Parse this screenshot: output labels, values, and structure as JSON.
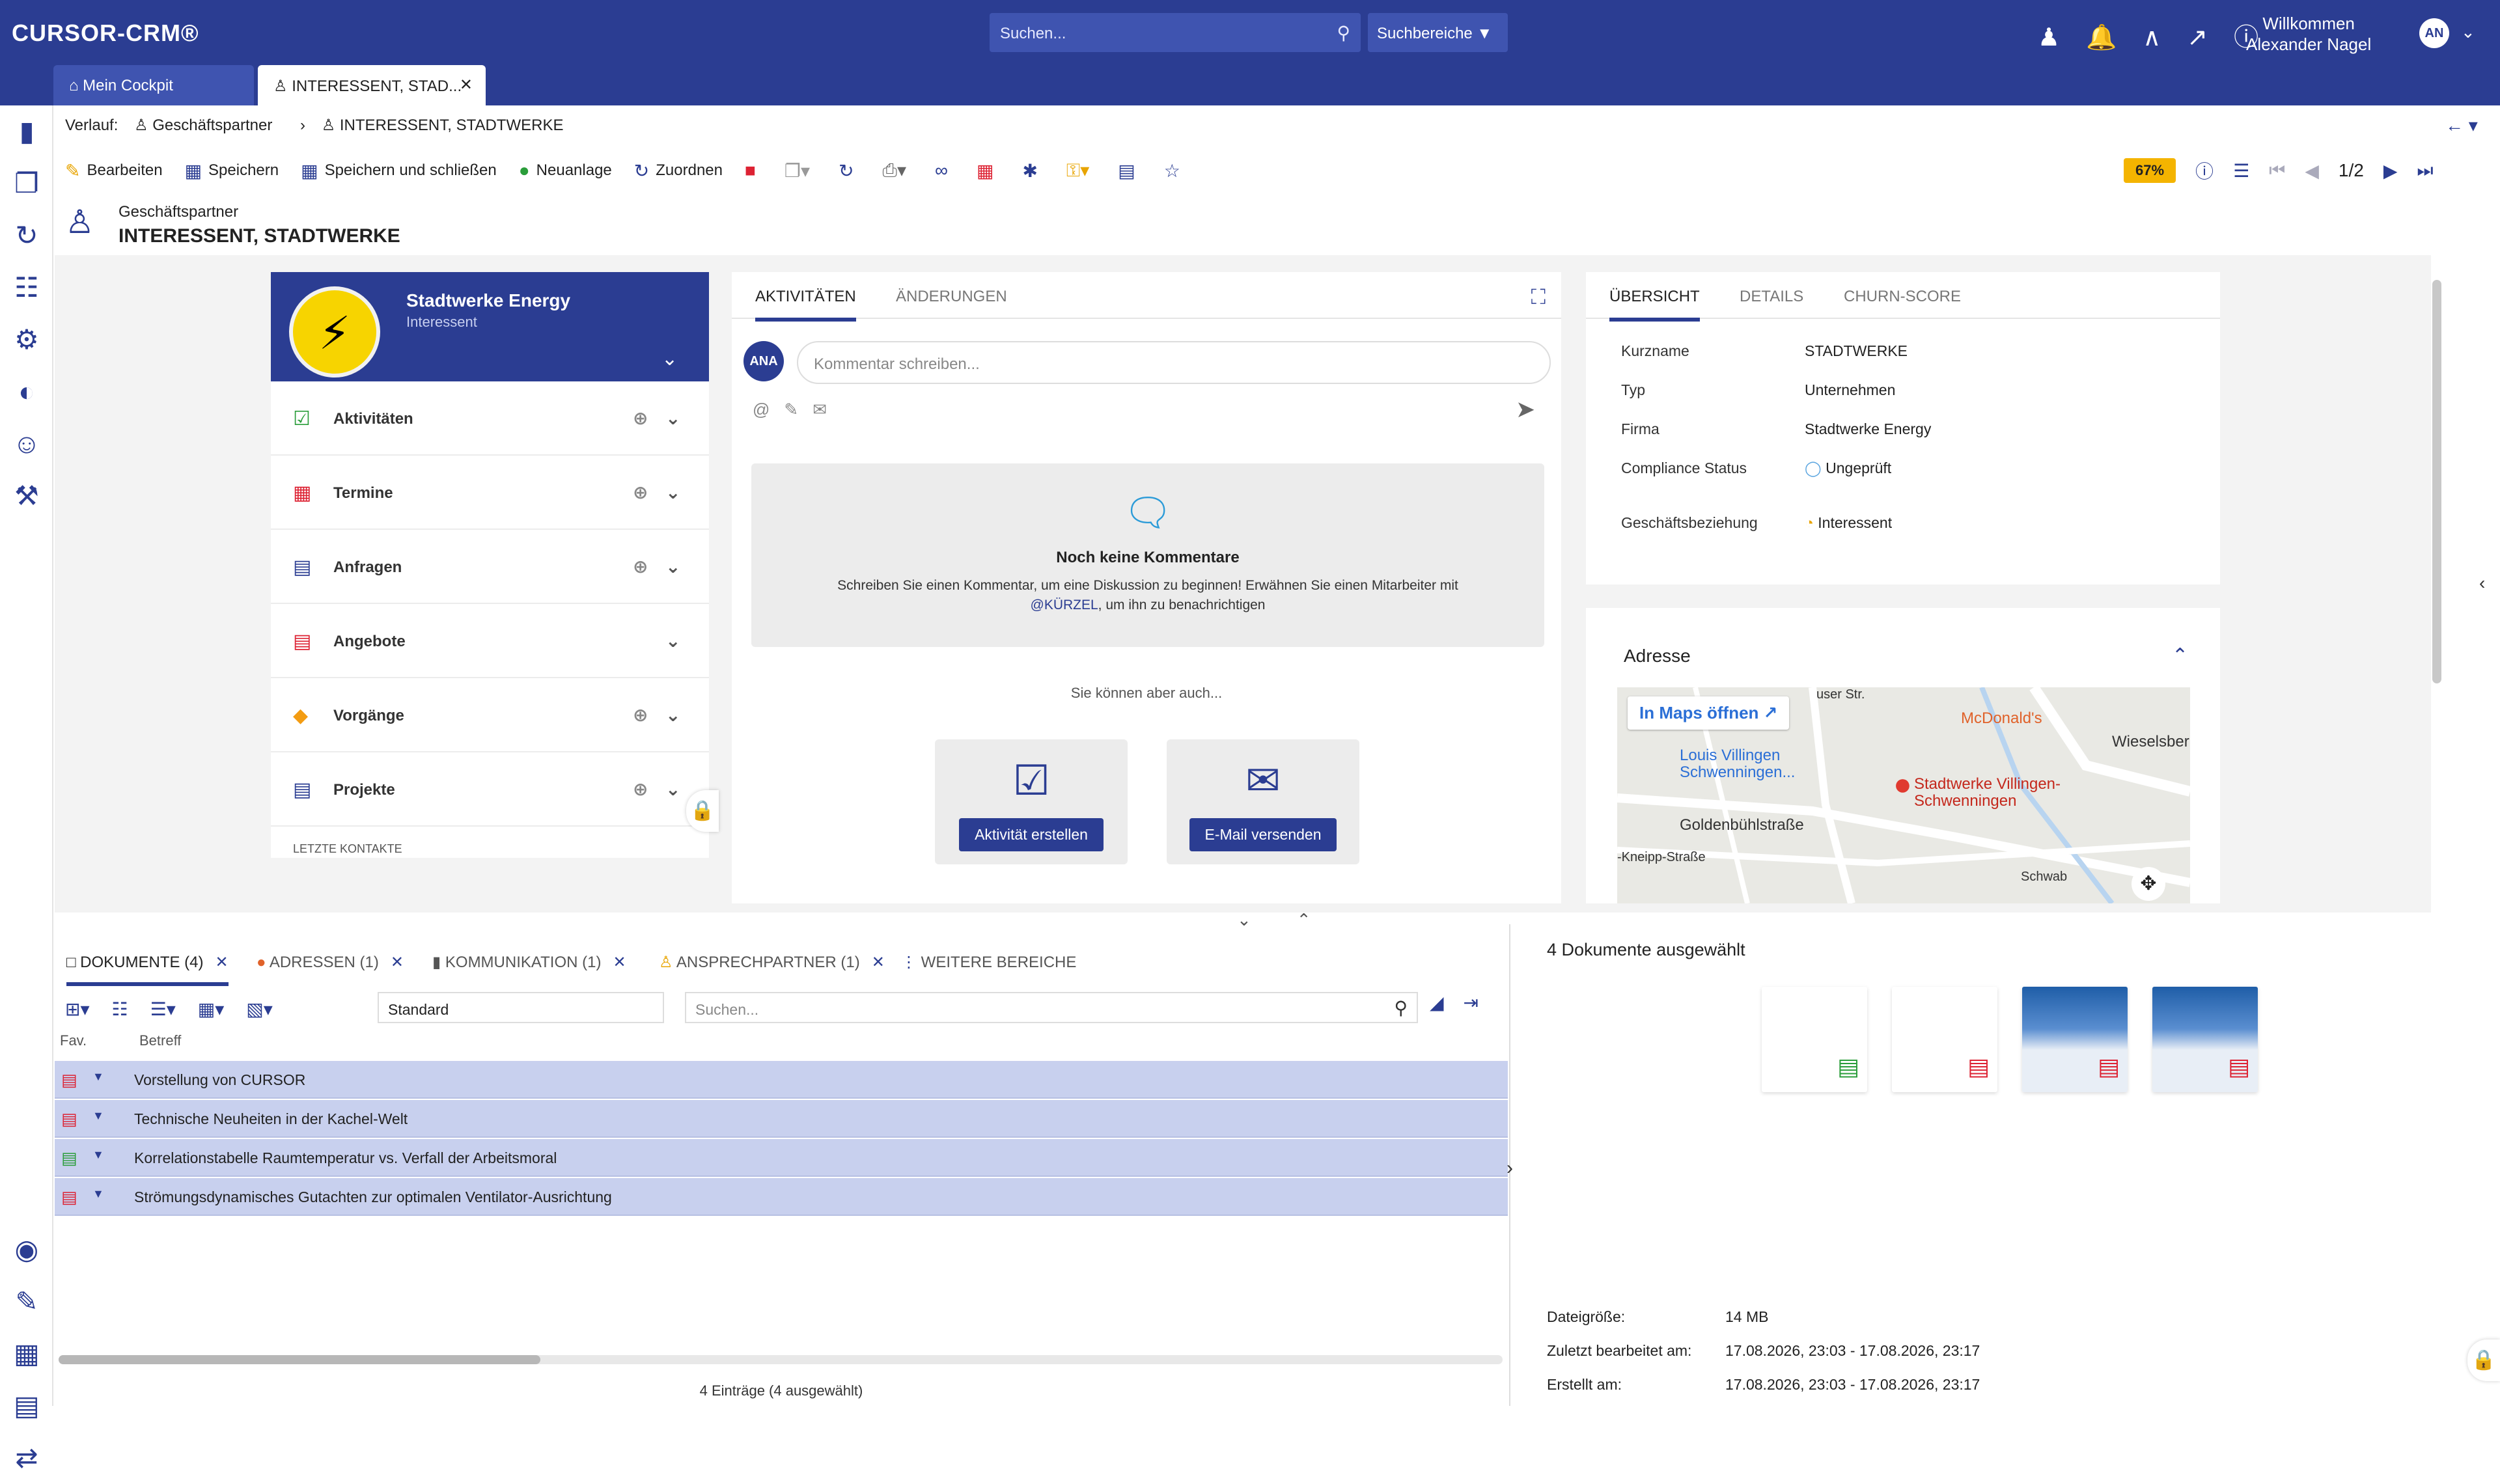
{
  "app": {
    "logo": "CURSOR-CRM®",
    "search_placeholder": "Suchen...",
    "search_area": "Suchbereiche",
    "welcome": "Willkommen",
    "user": "Alexander Nagel",
    "avatar": "AN"
  },
  "tabs": [
    {
      "label": "Mein Cockpit"
    },
    {
      "label": "INTERESSENT, STAD..."
    }
  ],
  "breadcrumb": {
    "prefix": "Verlauf:",
    "items": [
      "Geschäftspartner",
      "INTERESSENT, STADTWERKE"
    ]
  },
  "toolbar": {
    "edit": "Bearbeiten",
    "save": "Speichern",
    "save_close": "Speichern und schließen",
    "new": "Neuanlage",
    "assign": "Zuordnen",
    "completeness": "67%",
    "pager": "1/2"
  },
  "header": {
    "type": "Geschäftspartner",
    "title": "INTERESSENT, STADTWERKE"
  },
  "company": {
    "name": "Stadtwerke Energy",
    "status": "Interessent"
  },
  "sections": [
    "Aktivitäten",
    "Termine",
    "Anfragen",
    "Angebote",
    "Vorgänge",
    "Projekte"
  ],
  "sections_footer": "LETZTE KONTAKTE",
  "activity": {
    "tabs": [
      "AKTIVITÄTEN",
      "ÄNDERUNGEN"
    ],
    "avatar": "ANA",
    "comment_placeholder": "Kommentar schreiben...",
    "empty_title": "Noch keine Kommentare",
    "empty_text": "Schreiben Sie einen Kommentar, um eine Diskussion zu beginnen! Erwähnen Sie einen Mitarbeiter mit",
    "empty_mention": "@KÜRZEL",
    "empty_text2": ", um ihn zu benachrichtigen",
    "also": "Sie können aber auch...",
    "btn_activity": "Aktivität erstellen",
    "btn_mail": "E-Mail versenden"
  },
  "overview": {
    "tabs": [
      "ÜBERSICHT",
      "DETAILS",
      "CHURN-SCORE"
    ],
    "fields": [
      {
        "label": "Kurzname",
        "value": "STADTWERKE"
      },
      {
        "label": "Typ",
        "value": "Unternehmen"
      },
      {
        "label": "Firma",
        "value": "Stadtwerke Energy"
      },
      {
        "label": "Compliance Status",
        "value": "Ungeprüft"
      },
      {
        "label": "Geschäftsbeziehung",
        "value": "Interessent"
      }
    ]
  },
  "address": {
    "title": "Adresse",
    "open_maps": "In Maps öffnen",
    "map_labels": [
      "McDonald's",
      "Louis Villingen Schwenningen...",
      "Stadtwerke Villingen-Schwenningen",
      "Goldenbühlstraße",
      "Wieselsber",
      "-Kneipp-Straße",
      "user Str.",
      "Schwab"
    ]
  },
  "bottom_tabs": [
    {
      "label": "DOKUMENTE (4)"
    },
    {
      "label": "ADRESSEN (1)"
    },
    {
      "label": "KOMMUNIKATION (1)"
    },
    {
      "label": "ANSPRECHPARTNER (1)"
    },
    {
      "label": "WEITERE BEREICHE"
    }
  ],
  "docs": {
    "view": "Standard",
    "search_placeholder": "Suchen...",
    "columns": [
      "Fav.",
      "Betreff"
    ],
    "rows": [
      {
        "icon": "pptx",
        "title": "Vorstellung von CURSOR"
      },
      {
        "icon": "pptx",
        "title": "Technische Neuheiten in der Kachel-Welt"
      },
      {
        "icon": "xlsx",
        "title": "Korrelationstabelle Raumtemperatur vs. Verfall der Arbeitsmoral"
      },
      {
        "icon": "pdf",
        "title": "Strömungsdynamisches Gutachten zur optimalen Ventilator-Ausrichtung"
      }
    ],
    "count": "4 Einträge (4 ausgewählt)"
  },
  "panel": {
    "title": "4 Dokumente ausgewählt",
    "meta": [
      {
        "label": "Dateigröße:",
        "value": "14 MB"
      },
      {
        "label": "Zuletzt bearbeitet am:",
        "value": "17.08.2026, 23:03 - 17.08.2026, 23:17"
      },
      {
        "label": "Erstellt am:",
        "value": "17.08.2026, 23:03 - 17.08.2026, 23:17"
      }
    ]
  },
  "colors": {
    "brand": "#2b3d92",
    "selection": "#c8d0ee",
    "accent": "#f4b400"
  }
}
